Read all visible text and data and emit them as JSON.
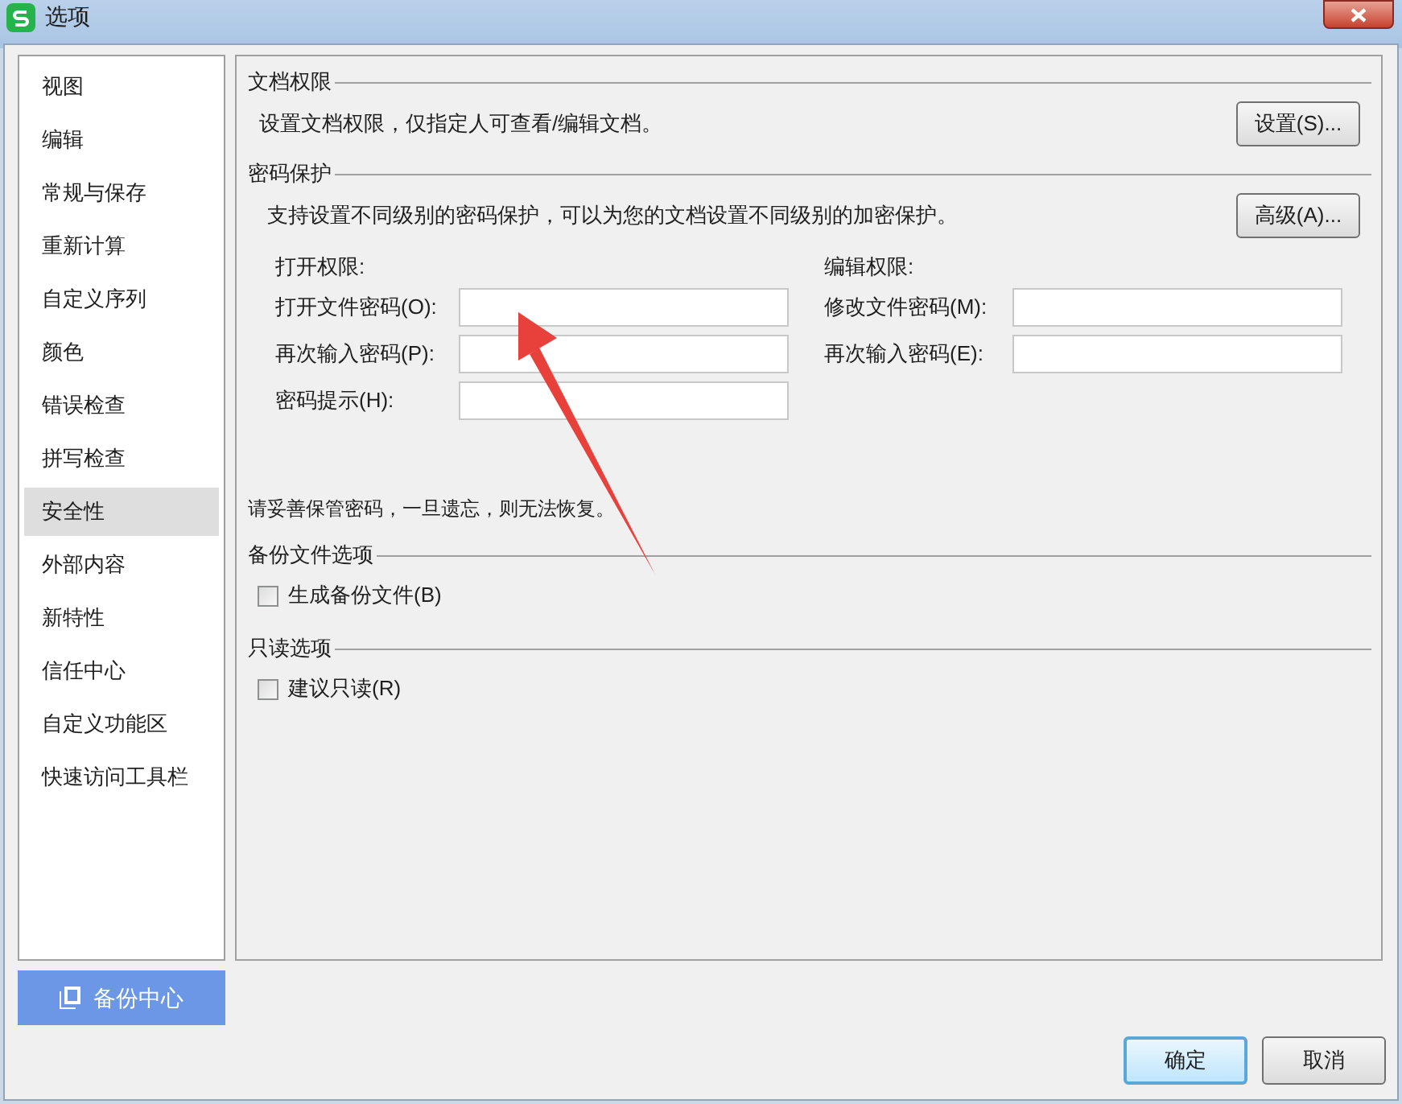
{
  "window": {
    "title": "选项"
  },
  "sidebar": {
    "items": [
      {
        "label": "视图",
        "selected": false
      },
      {
        "label": "编辑",
        "selected": false
      },
      {
        "label": "常规与保存",
        "selected": false
      },
      {
        "label": "重新计算",
        "selected": false
      },
      {
        "label": "自定义序列",
        "selected": false
      },
      {
        "label": "颜色",
        "selected": false
      },
      {
        "label": "错误检查",
        "selected": false
      },
      {
        "label": "拼写检查",
        "selected": false
      },
      {
        "label": "安全性",
        "selected": true
      },
      {
        "label": "外部内容",
        "selected": false
      },
      {
        "label": "新特性",
        "selected": false
      },
      {
        "label": "信任中心",
        "selected": false
      },
      {
        "label": "自定义功能区",
        "selected": false
      },
      {
        "label": "快速访问工具栏",
        "selected": false
      }
    ]
  },
  "backup_center_button": "备份中心",
  "document_permissions": {
    "heading": "文档权限",
    "description": "设置文档权限，仅指定人可查看/编辑文档。",
    "button": "设置(S)..."
  },
  "password_protection": {
    "heading": "密码保护",
    "description": "支持设置不同级别的密码保护，可以为您的文档设置不同级别的加密保护。",
    "button": "高级(A)...",
    "open_permissions": {
      "heading": "打开权限:",
      "fields": [
        {
          "label": "打开文件密码(O):"
        },
        {
          "label": "再次输入密码(P):"
        },
        {
          "label": "密码提示(H):"
        }
      ]
    },
    "edit_permissions": {
      "heading": "编辑权限:",
      "fields": [
        {
          "label": "修改文件密码(M):"
        },
        {
          "label": "再次输入密码(E):"
        }
      ]
    },
    "warning": "请妥善保管密码，一旦遗忘，则无法恢复。"
  },
  "backup_options": {
    "heading": "备份文件选项",
    "checkboxes": [
      {
        "label": "生成备份文件(B)",
        "checked": false
      }
    ]
  },
  "readonly_options": {
    "heading": "只读选项",
    "checkboxes": [
      {
        "label": "建议只读(R)",
        "checked": false
      }
    ]
  },
  "buttons": [
    "确定",
    "取消"
  ]
}
